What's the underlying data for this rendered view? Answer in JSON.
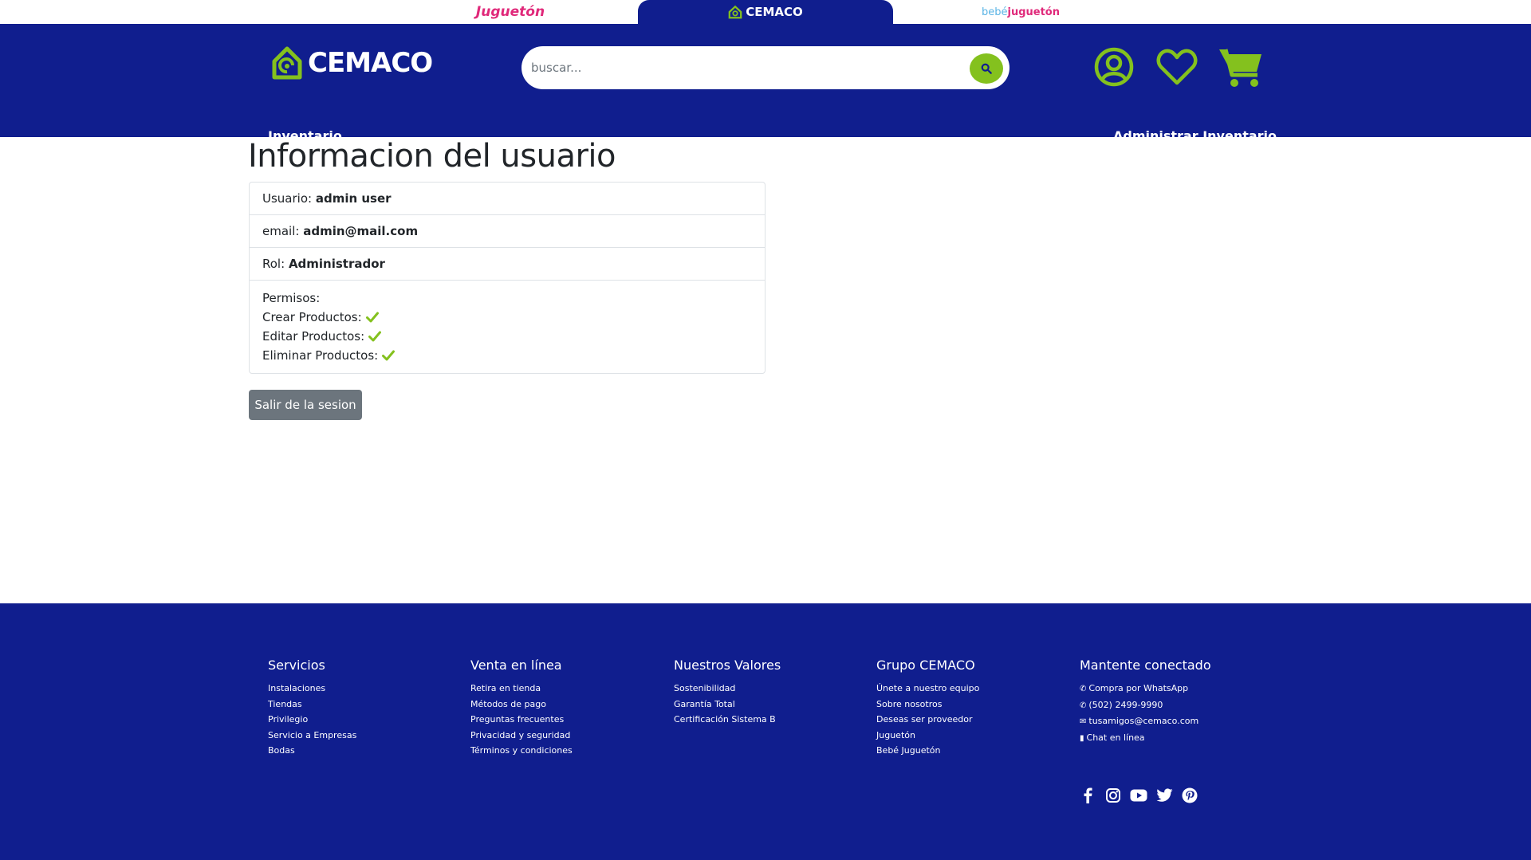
{
  "brand_strip": {
    "jugueton": "Juguetón",
    "cemaco": "CEMACO",
    "bebe_prefix": "bebé",
    "bebe_suffix": "juguetón"
  },
  "header": {
    "logo_text": "CEMACO",
    "search_placeholder": "buscar...",
    "nav_left": "Inventario",
    "nav_right": "Administrar Inventario"
  },
  "colors": {
    "brand_blue": "#101e8e",
    "accent_green": "#84c11e",
    "secondary_button": "#6c757d"
  },
  "main": {
    "title": "Informacion del usuario",
    "usuario_label": "Usuario:",
    "usuario_value": "admin user",
    "email_label": "email:",
    "email_value": "admin@mail.com",
    "rol_label": "Rol:",
    "rol_value": "Administrador",
    "permisos_label": "Permisos:",
    "permisos": [
      {
        "label": "Crear Productos:"
      },
      {
        "label": "Editar Productos:"
      },
      {
        "label": "Eliminar Productos:"
      }
    ],
    "logout_label": "Salir de la sesion"
  },
  "footer": {
    "servicios": {
      "title": "Servicios",
      "items": [
        "Instalaciones",
        "Tiendas",
        "Privilegio",
        "Servicio a Empresas",
        "Bodas"
      ]
    },
    "venta": {
      "title": "Venta en línea",
      "items": [
        "Retira en tienda",
        "Métodos de pago",
        "Preguntas frecuentes",
        "Privacidad y seguridad",
        "Términos y condiciones"
      ]
    },
    "valores": {
      "title": "Nuestros Valores",
      "items": [
        "Sostenibilidad",
        "Garantía Total",
        "Certificación Sistema B"
      ]
    },
    "grupo": {
      "title": "Grupo CEMACO",
      "items": [
        "Únete a nuestro equipo",
        "Sobre nosotros",
        "Deseas ser proveedor",
        "Juguetón",
        "Bebé Juguetón"
      ]
    },
    "conectado": {
      "title": "Mantente conectado",
      "items": [
        "Compra por WhatsApp",
        "(502) 2499-9990",
        "tusamigos@cemaco.com",
        "Chat en línea"
      ]
    },
    "social_icons": [
      "facebook-icon",
      "instagram-icon",
      "youtube-icon",
      "twitter-icon",
      "pinterest-icon"
    ]
  }
}
